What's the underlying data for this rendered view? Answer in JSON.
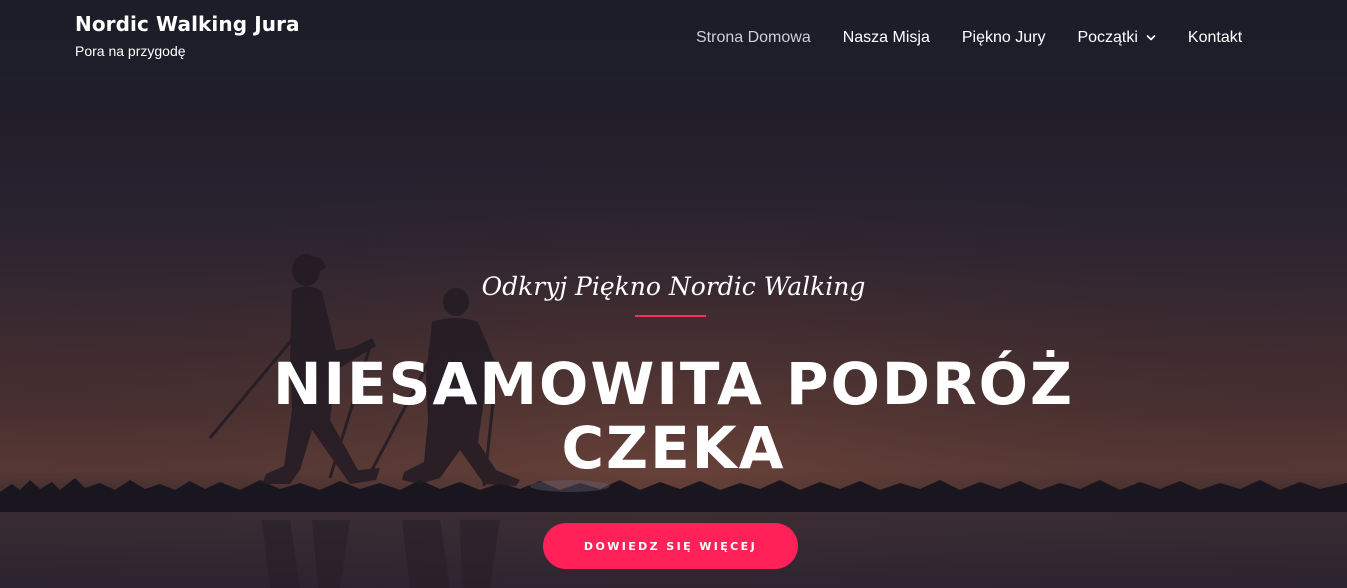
{
  "header": {
    "site_title": "Nordic Walking Jura",
    "tagline": "Pora na przygodę"
  },
  "nav": {
    "items": [
      {
        "label": "Strona Domowa",
        "active": true
      },
      {
        "label": "Nasza Misja"
      },
      {
        "label": "Piękno Jury"
      },
      {
        "label": "Początki",
        "has_dropdown": true
      },
      {
        "label": "Kontakt"
      }
    ]
  },
  "hero": {
    "subtitle": "Odkryj Piękno Nordic Walking",
    "headline_line1": "NIESAMOWITA PODRÓŻ",
    "headline_line2": "CZEKA",
    "cta_label": "DOWIEDZ SIĘ WIĘCEJ"
  },
  "colors": {
    "accent": "#ff2158",
    "nav_active": "#cfcfd6",
    "text": "#ffffff"
  },
  "icons": {
    "dropdown": "chevron-down-icon"
  }
}
